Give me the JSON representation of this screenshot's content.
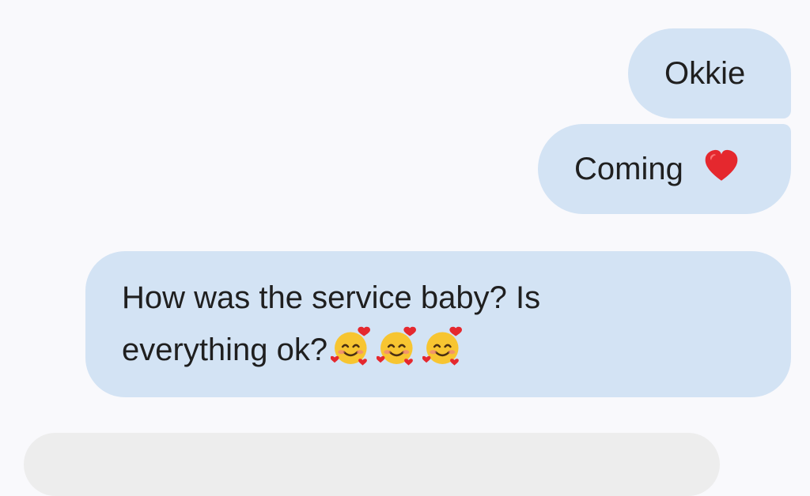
{
  "messages": [
    {
      "id": "msg-1",
      "direction": "outgoing",
      "text": "Okkie",
      "emoji": []
    },
    {
      "id": "msg-2",
      "direction": "outgoing",
      "text": "Coming",
      "emoji": [
        "red-heart"
      ]
    },
    {
      "id": "msg-3",
      "direction": "outgoing",
      "line1": "How was the service baby? Is",
      "line2": "everything ok?",
      "emoji": [
        "smiling-face-with-hearts",
        "smiling-face-with-hearts",
        "smiling-face-with-hearts"
      ]
    }
  ],
  "colors": {
    "background": "#f9f9fc",
    "bubble": "#d3e3f4",
    "text": "#1f1f1f",
    "compose": "#ededed"
  }
}
